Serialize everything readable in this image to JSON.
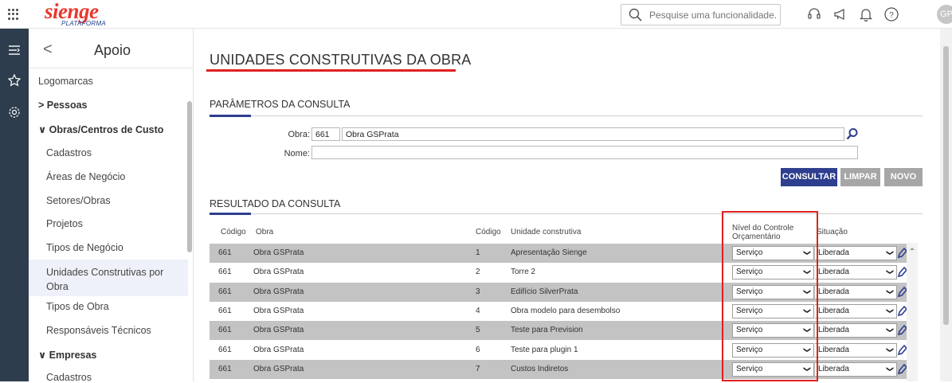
{
  "header": {
    "logo_main": "sienge",
    "logo_sub": "PLATAFORMA",
    "search_placeholder": "Pesquise uma funcionalidade.",
    "avatar_initials": "GP"
  },
  "sidebar": {
    "title": "Apoio",
    "back": "<",
    "items": [
      {
        "label": "Logomarcas",
        "type": "plain"
      },
      {
        "label": "> Pessoas",
        "type": "bold"
      },
      {
        "label": "∨ Obras/Centros de Custo",
        "type": "bold"
      },
      {
        "label": "Cadastros",
        "type": "sub"
      },
      {
        "label": "Áreas de Negócio",
        "type": "sub"
      },
      {
        "label": "Setores/Obras",
        "type": "sub"
      },
      {
        "label": "Projetos",
        "type": "sub"
      },
      {
        "label": "Tipos de Negócio",
        "type": "sub"
      },
      {
        "label": "Unidades Construtivas por Obra",
        "type": "active"
      },
      {
        "label": "Tipos de Obra",
        "type": "sub"
      },
      {
        "label": "Responsáveis Técnicos",
        "type": "sub"
      },
      {
        "label": "∨ Empresas",
        "type": "bold"
      },
      {
        "label": "Cadastros",
        "type": "sub"
      }
    ]
  },
  "page": {
    "title": "UNIDADES CONSTRUTIVAS DA OBRA",
    "params_title": "PARÂMETROS DA CONSULTA",
    "obra_label": "Obra:",
    "obra_code": "661",
    "obra_name": "Obra GSPrata",
    "nome_label": "Nome:",
    "nome_value": "",
    "btn_consultar": "CONSULTAR",
    "btn_limpar": "LIMPAR",
    "btn_novo": "NOVO",
    "result_title": "RESULTADO DA CONSULTA"
  },
  "table": {
    "headers": {
      "codigo": "Código",
      "obra": "Obra",
      "codigo2": "Código",
      "unidade": "Unidade construtiva",
      "nivel_line1": "Nível do Controle",
      "nivel_line2": "Orçamentário",
      "situacao": "Situação"
    },
    "rows": [
      {
        "codigo": "661",
        "obra": "Obra GSPrata",
        "cod": "1",
        "unidade": "Apresentação Sienge",
        "nivel": "Serviço",
        "situacao": "Liberada"
      },
      {
        "codigo": "661",
        "obra": "Obra GSPrata",
        "cod": "2",
        "unidade": "Torre 2",
        "nivel": "Serviço",
        "situacao": "Liberada"
      },
      {
        "codigo": "661",
        "obra": "Obra GSPrata",
        "cod": "3",
        "unidade": "Edifício SilverPrata",
        "nivel": "Serviço",
        "situacao": "Liberada"
      },
      {
        "codigo": "661",
        "obra": "Obra GSPrata",
        "cod": "4",
        "unidade": "Obra modelo para desembolso",
        "nivel": "Serviço",
        "situacao": "Liberada"
      },
      {
        "codigo": "661",
        "obra": "Obra GSPrata",
        "cod": "5",
        "unidade": "Teste para Prevision",
        "nivel": "Serviço",
        "situacao": "Liberada"
      },
      {
        "codigo": "661",
        "obra": "Obra GSPrata",
        "cod": "6",
        "unidade": "Teste para plugin 1",
        "nivel": "Serviço",
        "situacao": "Liberada"
      },
      {
        "codigo": "661",
        "obra": "Obra GSPrata",
        "cod": "7",
        "unidade": "Custos Indiretos",
        "nivel": "Serviço",
        "situacao": "Liberada"
      }
    ]
  },
  "colors": {
    "brand_red": "#e8392e",
    "brand_blue": "#1f3f8a",
    "rail": "#2d3d4d",
    "accent_navy": "#2e3f8f",
    "highlight_red": "#e02020",
    "row_gray": "#c3c3c3",
    "btn_disabled": "#a6a6a6"
  }
}
